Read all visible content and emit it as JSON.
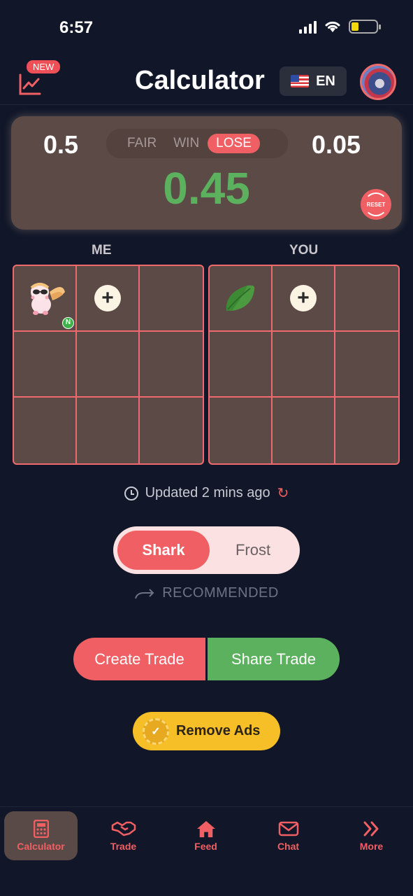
{
  "status_bar": {
    "time": "6:57"
  },
  "header": {
    "new_badge": "NEW",
    "title": "Calculator",
    "language": "EN",
    "flag_icon": "us-flag-icon"
  },
  "trade_value": {
    "me_value": "0.5",
    "you_value": "0.05",
    "tabs": [
      "FAIR",
      "WIN",
      "LOSE"
    ],
    "active_tab": "LOSE",
    "difference": "0.45",
    "reset_label": "RESET",
    "accent": "#ef5f63",
    "result_color": "#5cb15e"
  },
  "grids": {
    "me_label": "ME",
    "you_label": "YOU",
    "me_pet_badge": "N",
    "add_symbol": "+"
  },
  "updated_text": "Updated 2 mins ago",
  "value_source": {
    "options": [
      "Shark",
      "Frost"
    ],
    "selected": "Shark",
    "recommended_label": "RECOMMENDED"
  },
  "actions": {
    "create": "Create Trade",
    "share": "Share Trade",
    "remove_ads": "Remove Ads"
  },
  "nav": {
    "items": [
      {
        "label": "Calculator",
        "icon": "calculator-icon",
        "active": true
      },
      {
        "label": "Trade",
        "icon": "handshake-icon"
      },
      {
        "label": "Feed",
        "icon": "home-icon"
      },
      {
        "label": "Chat",
        "icon": "mail-icon"
      },
      {
        "label": "More",
        "icon": "double-chevron-right-icon"
      }
    ]
  }
}
